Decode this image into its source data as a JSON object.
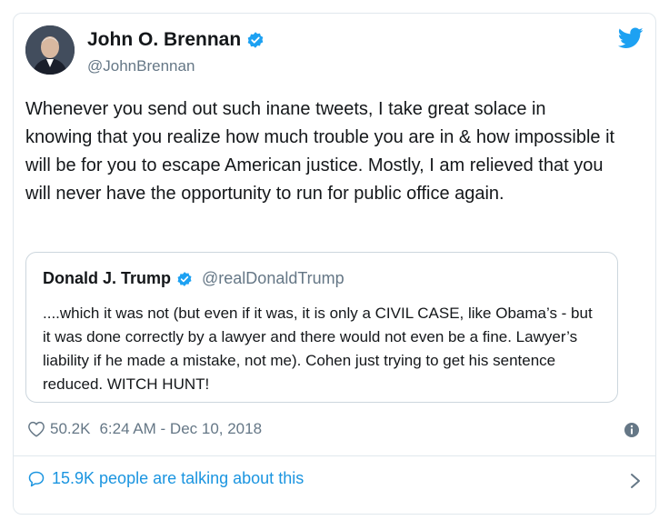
{
  "tweet": {
    "author": {
      "name": "John O. Brennan",
      "handle": "@JohnBrennan",
      "verified": true
    },
    "text": "Whenever you send out such inane tweets, I take great solace in knowing that you realize how much trouble you are in & how impossible it will be for you to escape American justice. Mostly, I am relieved that you will never have the opportunity to run for public office again.",
    "quoted": {
      "author": {
        "name": "Donald J. Trump",
        "handle": "@realDonaldTrump",
        "verified": true
      },
      "text": "....which it was not (but even if it was, it is only a CIVIL CASE, like Obama’s - but it was done correctly by a lawyer and there would not even be a fine. Lawyer’s liability if he made a mistake, not me). Cohen just trying to get his sentence reduced. WITCH HUNT!"
    },
    "likes": "50.2K",
    "timestamp": "6:24 AM - Dec 10, 2018",
    "talking": "15.9K people are talking about this"
  },
  "icons": {
    "bird": "twitter-bird-icon",
    "verified": "verified-badge-icon",
    "heart": "heart-icon",
    "info": "info-icon",
    "comment": "comment-bubble-icon",
    "chevron": "chevron-right-icon"
  },
  "colors": {
    "accent": "#1da1f2",
    "link": "#1b95e0",
    "muted": "#657786",
    "border": "#e1e8ed"
  }
}
